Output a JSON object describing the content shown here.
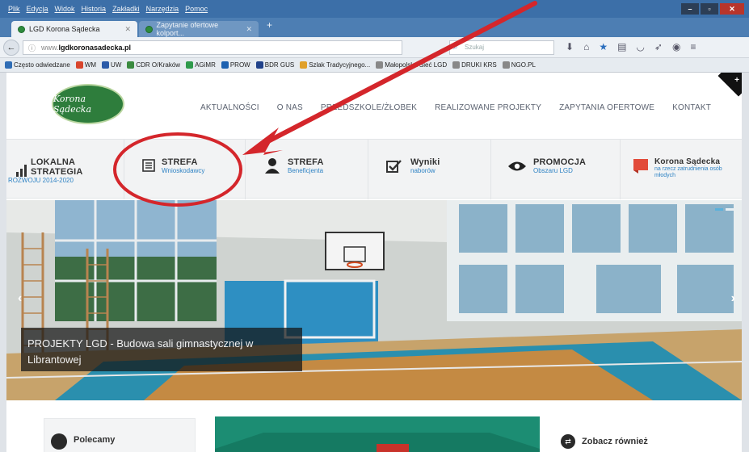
{
  "browser": {
    "menu": [
      "Plik",
      "Edycja",
      "Widok",
      "Historia",
      "Zakładki",
      "Narzędzia",
      "Pomoc"
    ],
    "tabs": [
      {
        "label": "LGD Korona Sądecka"
      },
      {
        "label": "Zapytanie ofertowe kolport..."
      }
    ],
    "url_prefix": "www.",
    "url_domain": "lgdkoronasadecka.pl",
    "search_placeholder": "Szukaj",
    "bookmarks": [
      {
        "label": "Często odwiedzane",
        "color": "#2f6db5"
      },
      {
        "label": "WM",
        "color": "#d8452c"
      },
      {
        "label": "UW",
        "color": "#2b5aa8"
      },
      {
        "label": "CDR O/Kraków",
        "color": "#3a8a3f"
      },
      {
        "label": "AGiMR",
        "color": "#2e9a4b"
      },
      {
        "label": "PROW",
        "color": "#1e62b0"
      },
      {
        "label": "BDR GUS",
        "color": "#21428a"
      },
      {
        "label": "Szlak Tradycyjnego...",
        "color": "#e0a02a"
      },
      {
        "label": "Małopolska Sieć LGD",
        "color": "#888888"
      },
      {
        "label": "DRUKI KRS",
        "color": "#888888"
      },
      {
        "label": "NGO.PL",
        "color": "#888888"
      }
    ]
  },
  "site": {
    "logo_text": "Korona Sądecka",
    "nav": [
      "AKTUALNOŚCI",
      "O NAS",
      "PRZEDSZKOLE/ŻŁOBEK",
      "REALIZOWANE PROJEKTY",
      "ZAPYTANIA OFERTOWE",
      "KONTAKT"
    ],
    "strip": [
      {
        "title1": "LOKALNA",
        "title2": "STRATEGIA",
        "sub": "ROZWOJU 2014-2020",
        "icon": "bar-chart-icon"
      },
      {
        "title1": "STREFA",
        "title2": "",
        "sub": "Wnioskodawcy",
        "icon": "document-icon"
      },
      {
        "title1": "STREFA",
        "title2": "",
        "sub": "Beneficjenta",
        "icon": "person-icon"
      },
      {
        "title1": "Wyniki",
        "title2": "",
        "sub": "naborów",
        "icon": "checkbox-icon"
      },
      {
        "title1": "PROMOCJA",
        "title2": "",
        "sub": "Obszaru LGD",
        "icon": "eye-icon"
      },
      {
        "title1": "Korona Sądecka",
        "title2": "",
        "sub": "na rzecz zatrudnienia osób młodych",
        "icon": "flag-icon"
      }
    ],
    "hero_caption_1": "PROJEKTY LGD - Budowa sali gimnastycznej w",
    "hero_caption_2": "Librantowej",
    "card_label": "Polecamy",
    "see_also": "Zobacz również"
  },
  "colors": {
    "accent_blue": "#2f83c4",
    "annotation_red": "#d4262b"
  }
}
